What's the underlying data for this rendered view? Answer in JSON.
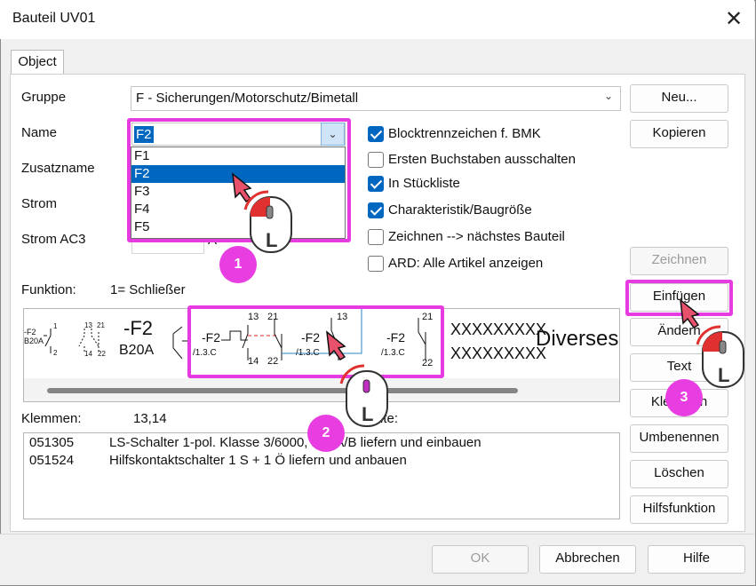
{
  "window": {
    "title": "Bauteil UV01",
    "close_glyph": "✕"
  },
  "tabs": [
    {
      "label": "Object"
    }
  ],
  "form": {
    "gruppe_label": "Gruppe",
    "gruppe_value": "F - Sicherungen/Motorschutz/Bimetall",
    "name_label": "Name",
    "name_value": "F2",
    "zusatzname_label": "Zusatzname",
    "strom_label": "Strom",
    "strom_ac3_label": "Strom AC3",
    "strom_ac3_unit": "A",
    "name_options": [
      "F1",
      "F2",
      "F3",
      "F4",
      "F5"
    ],
    "name_selected": "F2"
  },
  "checkboxes": [
    {
      "label": "Blocktrennzeichen f. BMK",
      "checked": true
    },
    {
      "label": "Ersten Buchstaben ausschalten",
      "checked": false
    },
    {
      "label": "In Stückliste",
      "checked": true
    },
    {
      "label": "Charakteristik/Baugröße",
      "checked": true
    },
    {
      "label": "Zeichnen --> nächstes Bauteil",
      "checked": false
    },
    {
      "label": "ARD: Alle Artikel anzeigen",
      "checked": false
    }
  ],
  "buttons": {
    "neu": "Neu...",
    "kopieren": "Kopieren",
    "zeichnen": "Zeichnen",
    "einfuegen": "Einfügen",
    "aendern": "Ändern",
    "text": "Text",
    "klemmen": "Klemmen",
    "umbenennen": "Umbenennen",
    "loeschen": "Löschen",
    "hilfsfunktion": "Hilfsfunktion",
    "ok": "OK",
    "abbrechen": "Abbrechen",
    "hilfe": "Hilfe"
  },
  "funktion": {
    "label": "Funktion:",
    "value": "1= Schließer"
  },
  "preview": {
    "sym1_tag": "-F2",
    "sym1_sub": "B20A",
    "sym1_n1": "1",
    "sym1_n2": "2",
    "sym2_n1": "13",
    "sym2_n2": "21",
    "sym2_n3": "14",
    "sym2_n4": "22",
    "sym3_tag": "-F2",
    "sym3_sub": "B20A",
    "sel1_tag": "-F2",
    "sel1_ref": "/1.3.C",
    "sel1_n1": "13",
    "sel1_n2": "21",
    "sel1_n3": "14",
    "sel1_n4": "22",
    "sel2_tag": "-F2",
    "sel2_ref": "/1.3.C",
    "sel2_n1": "13",
    "sel3_tag": "-F2",
    "sel3_ref": "/1.3.C",
    "sel3_n1": "21",
    "sel3_n2": "22",
    "xx1": "XXXXXXXXX",
    "xx2": "XXXXXXXXX",
    "diverses": "Diverses"
  },
  "klemmen": {
    "label": "Klemmen:",
    "value": "13,14",
    "extra": "ite:"
  },
  "articles": [
    {
      "nr": "051305",
      "text": "LS-Schalter 1-pol. Klasse 3/6000, B20A/B liefern und einbauen"
    },
    {
      "nr": "051524",
      "text": "Hilfskontaktschalter 1 S + 1 Ö liefern und anbauen"
    }
  ],
  "annotations": {
    "step1": "1",
    "step2": "2",
    "step3": "3",
    "mouse_letter": "L",
    "accent": "#e53be0"
  }
}
